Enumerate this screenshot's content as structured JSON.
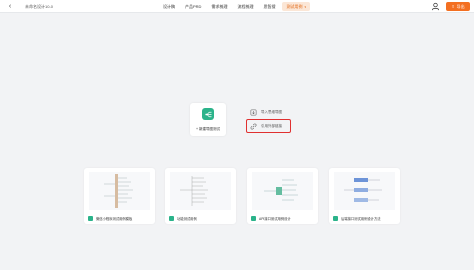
{
  "header": {
    "doc_title": "未命名设计10-0",
    "nav": [
      {
        "label": "设计稿",
        "active": false
      },
      {
        "label": "产品PRD",
        "active": false
      },
      {
        "label": "需求梳理",
        "active": false
      },
      {
        "label": "流程梳理",
        "active": false
      },
      {
        "label": "思智搜",
        "active": false
      },
      {
        "label": "测试用例",
        "active": true
      }
    ],
    "export_label": "导出"
  },
  "create": {
    "new_label": "+ 新建导图测试",
    "import_label": "导入思维导图",
    "link_label": "引用外部链接"
  },
  "templates": [
    {
      "name": "微信小程序测试用例模板"
    },
    {
      "name": "功能测试用例"
    },
    {
      "name": "API接口测试用例设计"
    },
    {
      "name": "后端接口测试用例设计方法"
    }
  ],
  "colors": {
    "accent": "#f36f21",
    "brand_green": "#2bb38a",
    "highlight": "#e03030"
  }
}
